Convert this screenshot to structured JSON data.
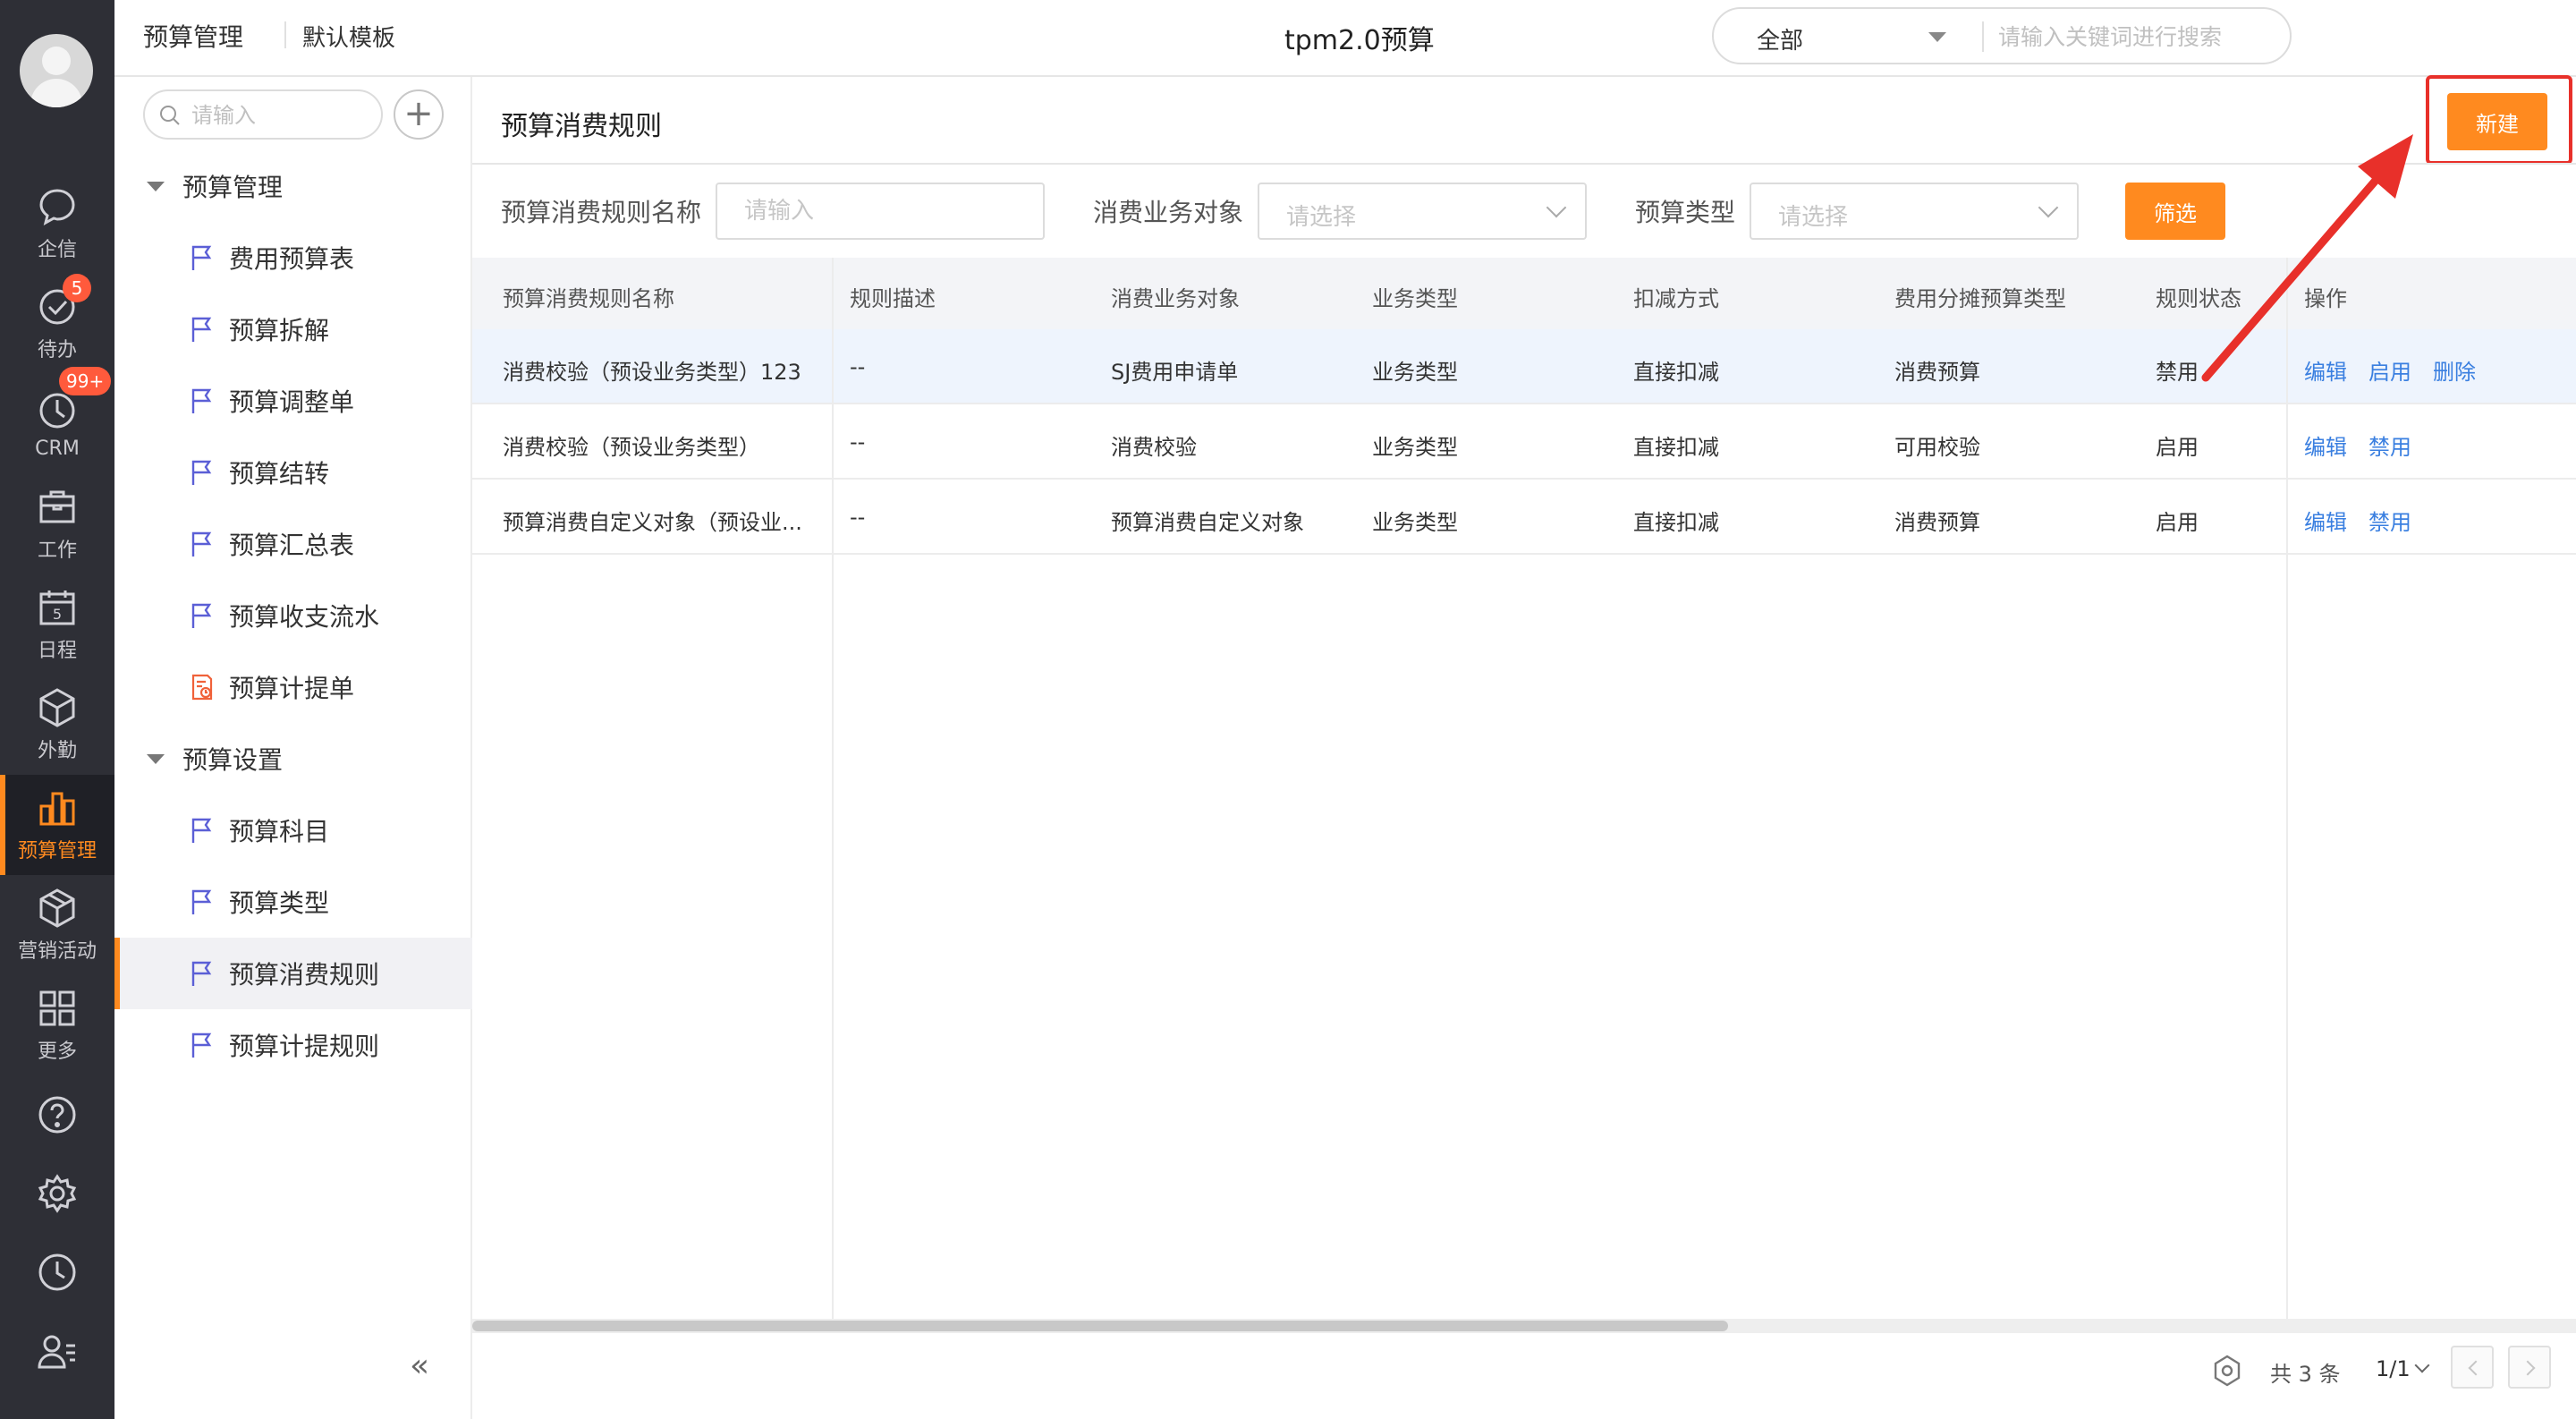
{
  "rail": {
    "items": [
      {
        "label": "企信",
        "icon": "chat-bubble-icon"
      },
      {
        "label": "待办",
        "icon": "check-circle-icon",
        "badge": "5"
      },
      {
        "label": "CRM",
        "icon": "clock-icon",
        "badge": "99+"
      },
      {
        "label": "工作",
        "icon": "briefcase-icon"
      },
      {
        "label": "日程",
        "icon": "calendar-icon"
      },
      {
        "label": "外勤",
        "icon": "cube-icon"
      },
      {
        "label": "预算管理",
        "icon": "bar-chart-icon",
        "active": true
      },
      {
        "label": "营销活动",
        "icon": "box-icon"
      },
      {
        "label": "更多",
        "icon": "grid-icon"
      }
    ],
    "tools": [
      "help-icon",
      "settings-icon",
      "history-icon",
      "contacts-icon"
    ],
    "accent": "#ff8a1f"
  },
  "topbar": {
    "app_name": "预算管理",
    "template": "默认模板",
    "title": "tpm2.0预算",
    "search": {
      "scope": "全部",
      "placeholder": "请输入关键词进行搜索"
    }
  },
  "sidebar": {
    "search_placeholder": "请输入",
    "add_label": "+",
    "groups": [
      {
        "label": "预算管理",
        "items": [
          {
            "label": "费用预算表",
            "icon": "flag-icon"
          },
          {
            "label": "预算拆解",
            "icon": "flag-icon"
          },
          {
            "label": "预算调整单",
            "icon": "flag-icon"
          },
          {
            "label": "预算结转",
            "icon": "flag-icon"
          },
          {
            "label": "预算汇总表",
            "icon": "flag-icon"
          },
          {
            "label": "预算收支流水",
            "icon": "flag-icon"
          },
          {
            "label": "预算计提单",
            "icon": "document-icon"
          }
        ]
      },
      {
        "label": "预算设置",
        "items": [
          {
            "label": "预算科目",
            "icon": "flag-icon"
          },
          {
            "label": "预算类型",
            "icon": "flag-icon"
          },
          {
            "label": "预算消费规则",
            "icon": "flag-icon",
            "active": true
          },
          {
            "label": "预算计提规则",
            "icon": "flag-icon"
          }
        ]
      }
    ],
    "collapse_label": "«"
  },
  "main": {
    "title": "预算消费规则",
    "new_button": "新建",
    "filters": {
      "name_label": "预算消费规则名称",
      "name_placeholder": "请输入",
      "object_label": "消费业务对象",
      "object_placeholder": "请选择",
      "type_label": "预算类型",
      "type_placeholder": "请选择",
      "filter_button": "筛选"
    },
    "table": {
      "columns": [
        "预算消费规则名称",
        "规则描述",
        "消费业务对象",
        "业务类型",
        "扣减方式",
        "费用分摊预算类型",
        "规则状态",
        "操作"
      ],
      "rows": [
        {
          "cells": [
            "消费校验（预设业务类型）123",
            "--",
            "SJ费用申请单",
            "业务类型",
            "直接扣减",
            "消费预算",
            "禁用"
          ],
          "actions": [
            "编辑",
            "启用",
            "删除"
          ],
          "selected": true
        },
        {
          "cells": [
            "消费校验（预设业务类型）",
            "--",
            "消费校验",
            "业务类型",
            "直接扣减",
            "可用校验",
            "启用"
          ],
          "actions": [
            "编辑",
            "禁用"
          ]
        },
        {
          "cells": [
            "预算消费自定义对象（预设业...",
            "--",
            "预算消费自定义对象",
            "业务类型",
            "直接扣减",
            "消费预算",
            "启用"
          ],
          "actions": [
            "编辑",
            "禁用"
          ]
        }
      ]
    },
    "pagination": {
      "total": "共 3 条",
      "page": "1/1"
    }
  },
  "annotation": {
    "color": "#e8302a"
  }
}
